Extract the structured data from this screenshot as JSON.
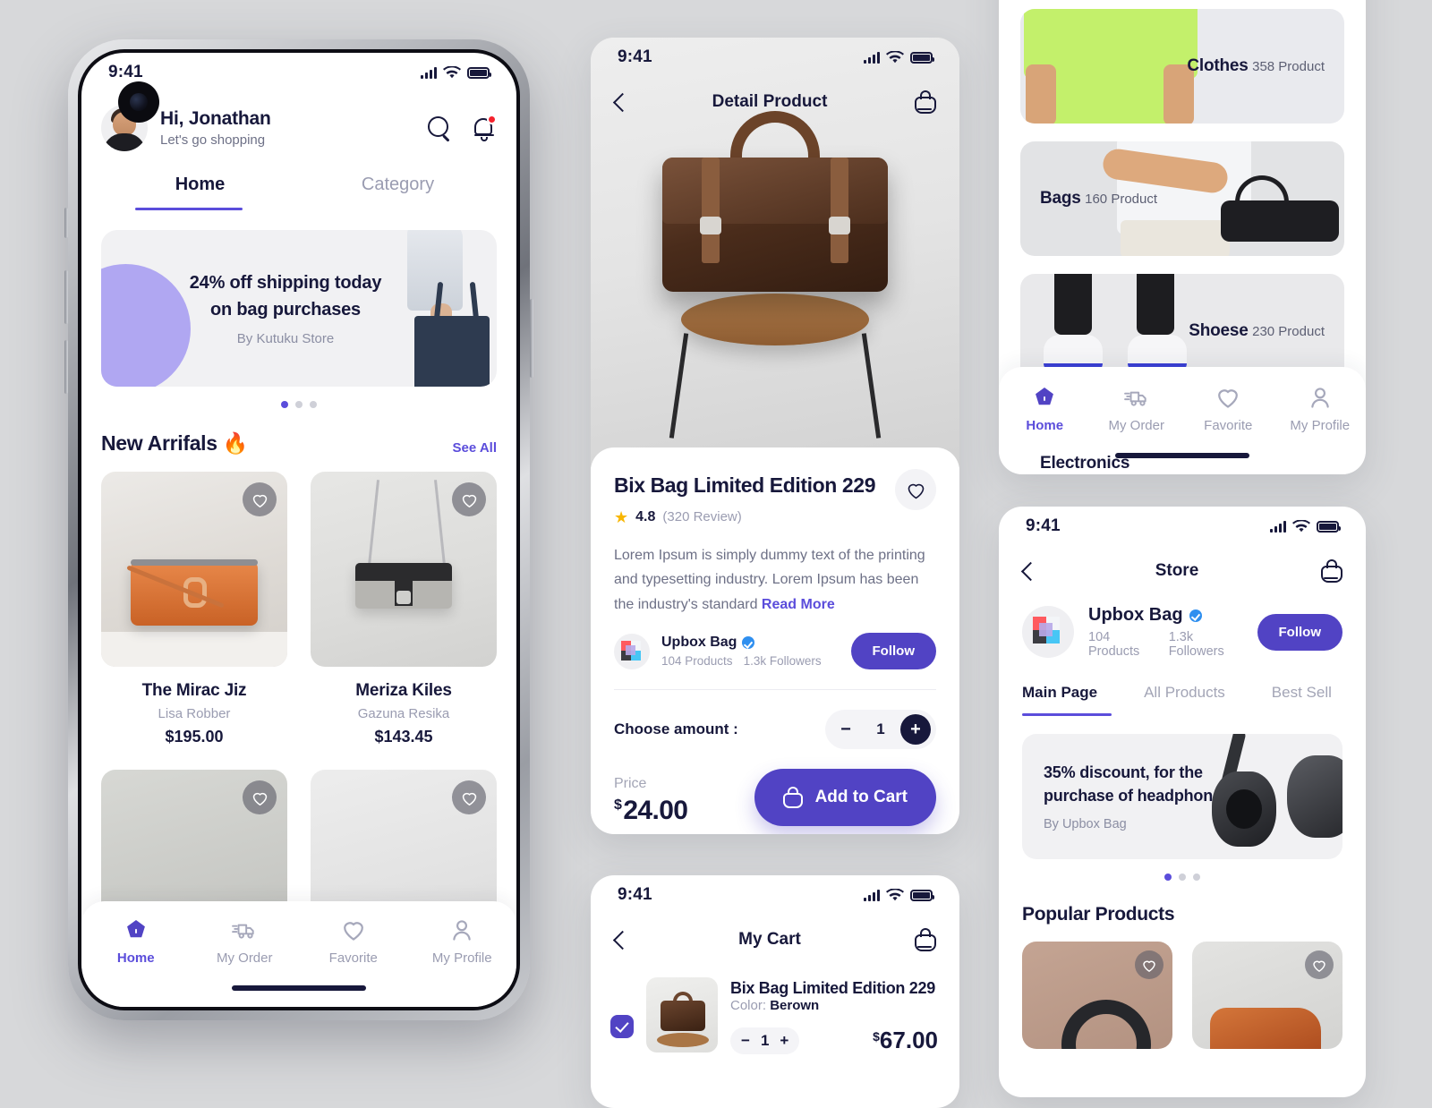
{
  "theme": {
    "accent": "#5143c4",
    "accent_light": "#5b4ddb",
    "ink": "#17183b",
    "muted": "#9a9cb1",
    "page_bg": "#d7d8da"
  },
  "home": {
    "status": {
      "time": "9:41"
    },
    "greeting": {
      "hi": "Hi, Jonathan",
      "sub": "Let's go shopping"
    },
    "icons": {
      "search": "search-icon",
      "bell": "bell-icon"
    },
    "tabs": [
      {
        "label": "Home",
        "active": true
      },
      {
        "label": "Category",
        "active": false
      }
    ],
    "banner": {
      "title_line1": "24% off shipping today",
      "title_line2": "on bag purchases",
      "by": "By Kutuku Store",
      "dots": 3,
      "active_dot": 0
    },
    "section": {
      "title": "New Arrifals 🔥",
      "see_all": "See All"
    },
    "products": [
      {
        "name": "The Mirac Jiz",
        "brand": "Lisa Robber",
        "price": "$195.00"
      },
      {
        "name": "Meriza Kiles",
        "brand": "Gazuna Resika",
        "price": "$143.45"
      }
    ],
    "nav": [
      {
        "label": "Home",
        "icon": "home-icon",
        "active": true
      },
      {
        "label": "My Order",
        "icon": "truck-icon",
        "active": false
      },
      {
        "label": "Favorite",
        "icon": "heart-icon",
        "active": false
      },
      {
        "label": "My Profile",
        "icon": "user-icon",
        "active": false
      }
    ]
  },
  "detail": {
    "status": {
      "time": "9:41"
    },
    "appbar": {
      "title": "Detail Product",
      "back": "back-icon",
      "bag": "bag-icon"
    },
    "product": {
      "title": "Bix Bag Limited Edition 229",
      "rating": "4.8",
      "reviews": "(320 Review)",
      "description": "Lorem Ipsum is simply dummy text of the printing and typesetting industry. Lorem Ipsum has been the industry's standard ",
      "read_more": "Read More"
    },
    "store": {
      "name": "Upbox Bag",
      "products": "104 Products",
      "followers": "1.3k Followers",
      "follow_label": "Follow",
      "verified": true
    },
    "amount": {
      "label": "Choose amount :",
      "value": "1",
      "minus": "−",
      "plus": "+"
    },
    "price": {
      "label": "Price",
      "currency": "$",
      "value": "24.00"
    },
    "cta": {
      "label": "Add to Cart",
      "icon": "bag-icon"
    }
  },
  "cart": {
    "status": {
      "time": "9:41"
    },
    "appbar": {
      "title": "My Cart",
      "back": "back-icon",
      "bag": "bag-icon"
    },
    "item": {
      "name": "Bix Bag Limited Edition 229",
      "color_label": "Color:",
      "color_value": "Berown",
      "qty": "1",
      "minus": "−",
      "plus": "+",
      "currency": "$",
      "price": "67.00",
      "checked": true
    }
  },
  "category": {
    "items": [
      {
        "name": "Clothes",
        "count": "358 Product",
        "align": "right"
      },
      {
        "name": "Bags",
        "count": "160 Product",
        "align": "left"
      },
      {
        "name": "Shoese",
        "count": "230 Product",
        "align": "right"
      },
      {
        "name": "Electronics",
        "count": "",
        "align": "left"
      }
    ],
    "nav": [
      {
        "label": "Home",
        "icon": "home-icon",
        "active": true
      },
      {
        "label": "My Order",
        "icon": "truck-icon",
        "active": false
      },
      {
        "label": "Favorite",
        "icon": "heart-icon",
        "active": false
      },
      {
        "label": "My Profile",
        "icon": "user-icon",
        "active": false
      }
    ]
  },
  "store_screen": {
    "status": {
      "time": "9:41"
    },
    "appbar": {
      "title": "Store",
      "back": "back-icon",
      "bag": "bag-icon"
    },
    "profile": {
      "name": "Upbox Bag",
      "products": "104 Products",
      "followers": "1.3k Followers",
      "follow_label": "Follow",
      "verified": true
    },
    "tabs": [
      {
        "label": "Main Page",
        "active": true
      },
      {
        "label": "All Products",
        "active": false
      },
      {
        "label": "Best Sell",
        "active": false
      }
    ],
    "promo": {
      "line1": "35% discount, for the",
      "line2": "purchase of headphones",
      "by": "By Upbox Bag",
      "dots": 3,
      "active_dot": 0
    },
    "popular": {
      "title": "Popular Products"
    }
  }
}
